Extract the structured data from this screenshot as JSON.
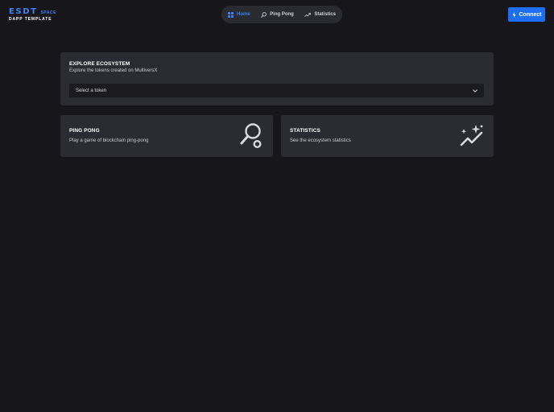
{
  "logo": {
    "main": "ESDT",
    "tag": "SPACE",
    "sub": "DAPP TEMPLATE"
  },
  "nav": {
    "items": [
      {
        "label": "Home",
        "icon": "grid-icon",
        "active": true
      },
      {
        "label": "Ping Pong",
        "icon": "racket-icon",
        "active": false
      },
      {
        "label": "Statistics",
        "icon": "chart-line-icon",
        "active": false
      }
    ]
  },
  "header": {
    "connect_label": "Connect",
    "connect_icon": "bolt-icon"
  },
  "explore": {
    "title": "EXPLORE ECOSYSTEM",
    "description": "Explore the tokens created on MultiversX",
    "select_placeholder": "Select a token"
  },
  "cards": [
    {
      "title": "PING PONG",
      "description": "Play a game of blockchain ping-pong",
      "icon": "racket-icon"
    },
    {
      "title": "STATISTICS",
      "description": "See the ecosystem statistics",
      "icon": "sparkle-chart-icon"
    }
  ],
  "colors": {
    "background": "#17171b",
    "card": "#2b2c31",
    "accent": "#1d6ef2"
  }
}
